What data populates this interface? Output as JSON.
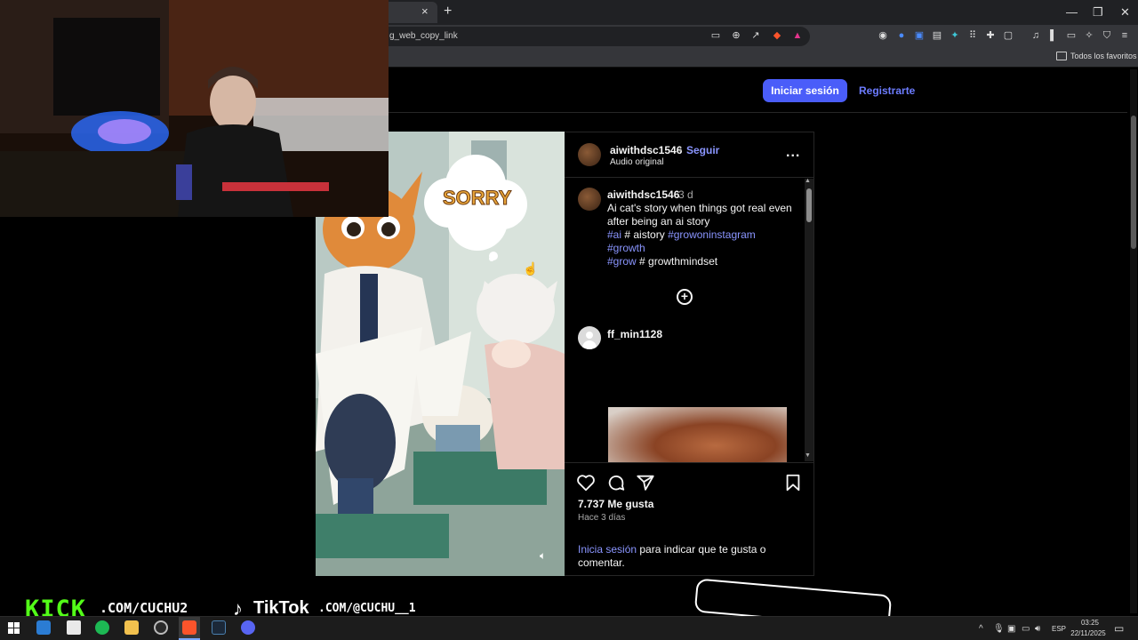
{
  "browser": {
    "url": "g_web_copy_link",
    "tab_close": "×",
    "new_tab": "+",
    "minimize": "—",
    "restore": "❐",
    "close": "✕",
    "bookmarks_folder": "Todos los favoritos"
  },
  "header": {
    "login_label": "Iniciar sesión",
    "register_label": "Registrarte"
  },
  "post": {
    "image_text": "SORRY",
    "author": "aiwithdsc1546",
    "separator": "•",
    "follow_label": "Seguir",
    "audio": "Audio original",
    "more": "...",
    "caption_user": "aiwithdsc1546",
    "caption_time": "3 d",
    "caption_text": "Ai cat's story when things got real even after being an ai story",
    "tag_ai": "#ai",
    "hash_aistory": "# aistory",
    "tag_growoninstagram": "#growoninstagram",
    "tag_growth": "#growth",
    "tag_grow": "#grow",
    "hash_growthmindset": "# growthmindset",
    "comment_user": "ff_min1128",
    "likes": "7.737 Me gusta",
    "ago": "Hace 3 días",
    "login_prompt_link": "Inicia sesión",
    "login_prompt_rest": " para indicar que te gusta o comentar."
  },
  "overlay": {
    "kick_logo": "KICK",
    "kick_url": ".COM/CUCHU2",
    "tiktok_label": "TikTok",
    "tiktok_url": ".COM/@CUCHU__1"
  },
  "taskbar": {
    "language": "ESP",
    "time": "03:25",
    "date": "22/11/2025"
  },
  "colors": {
    "accent": "#4a5df9",
    "link": "#8a95ff",
    "kick_green": "#53fc18"
  }
}
